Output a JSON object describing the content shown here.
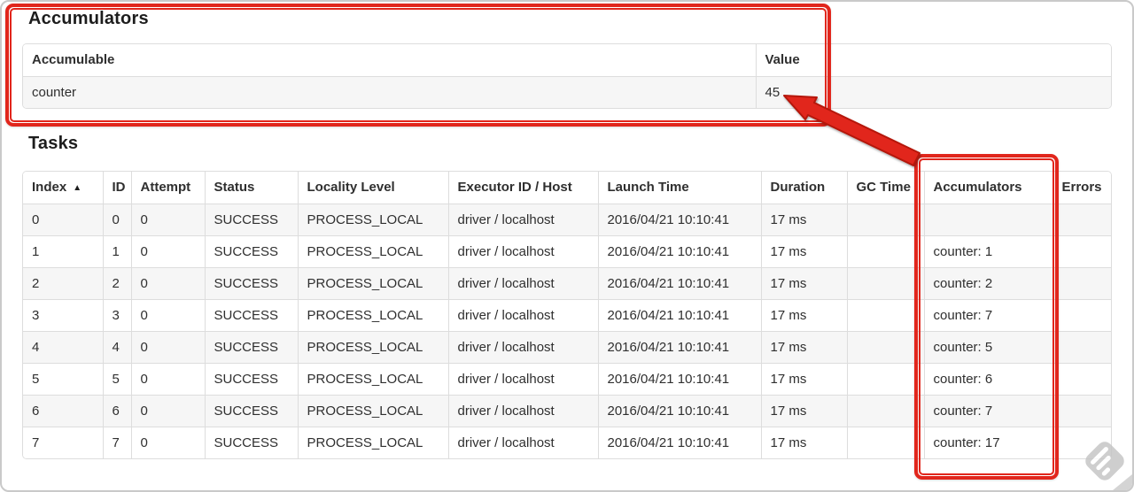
{
  "page": {
    "accumulators_heading": "Accumulators",
    "tasks_heading": "Tasks"
  },
  "accumulators_table": {
    "headers": [
      "Accumulable",
      "Value"
    ],
    "rows": [
      {
        "accumulable": "counter",
        "value": "45"
      }
    ]
  },
  "tasks_table": {
    "headers": [
      "Index",
      "ID",
      "Attempt",
      "Status",
      "Locality Level",
      "Executor ID / Host",
      "Launch Time",
      "Duration",
      "GC Time",
      "Accumulators",
      "Errors"
    ],
    "rows": [
      {
        "index": "0",
        "id": "0",
        "attempt": "0",
        "status": "SUCCESS",
        "locality": "PROCESS_LOCAL",
        "executor": "driver / localhost",
        "launch_time": "2016/04/21 10:10:41",
        "duration": "17 ms",
        "gc_time": "",
        "accumulators": "",
        "errors": ""
      },
      {
        "index": "1",
        "id": "1",
        "attempt": "0",
        "status": "SUCCESS",
        "locality": "PROCESS_LOCAL",
        "executor": "driver / localhost",
        "launch_time": "2016/04/21 10:10:41",
        "duration": "17 ms",
        "gc_time": "",
        "accumulators": "counter: 1",
        "errors": ""
      },
      {
        "index": "2",
        "id": "2",
        "attempt": "0",
        "status": "SUCCESS",
        "locality": "PROCESS_LOCAL",
        "executor": "driver / localhost",
        "launch_time": "2016/04/21 10:10:41",
        "duration": "17 ms",
        "gc_time": "",
        "accumulators": "counter: 2",
        "errors": ""
      },
      {
        "index": "3",
        "id": "3",
        "attempt": "0",
        "status": "SUCCESS",
        "locality": "PROCESS_LOCAL",
        "executor": "driver / localhost",
        "launch_time": "2016/04/21 10:10:41",
        "duration": "17 ms",
        "gc_time": "",
        "accumulators": "counter: 7",
        "errors": ""
      },
      {
        "index": "4",
        "id": "4",
        "attempt": "0",
        "status": "SUCCESS",
        "locality": "PROCESS_LOCAL",
        "executor": "driver / localhost",
        "launch_time": "2016/04/21 10:10:41",
        "duration": "17 ms",
        "gc_time": "",
        "accumulators": "counter: 5",
        "errors": ""
      },
      {
        "index": "5",
        "id": "5",
        "attempt": "0",
        "status": "SUCCESS",
        "locality": "PROCESS_LOCAL",
        "executor": "driver / localhost",
        "launch_time": "2016/04/21 10:10:41",
        "duration": "17 ms",
        "gc_time": "",
        "accumulators": "counter: 6",
        "errors": ""
      },
      {
        "index": "6",
        "id": "6",
        "attempt": "0",
        "status": "SUCCESS",
        "locality": "PROCESS_LOCAL",
        "executor": "driver / localhost",
        "launch_time": "2016/04/21 10:10:41",
        "duration": "17 ms",
        "gc_time": "",
        "accumulators": "counter: 7",
        "errors": ""
      },
      {
        "index": "7",
        "id": "7",
        "attempt": "0",
        "status": "SUCCESS",
        "locality": "PROCESS_LOCAL",
        "executor": "driver / localhost",
        "launch_time": "2016/04/21 10:10:41",
        "duration": "17 ms",
        "gc_time": "",
        "accumulators": "counter: 17",
        "errors": ""
      }
    ]
  },
  "icons": {
    "sort_ascending_icon": "▲"
  },
  "annotations": {
    "highlight_color": "#e1261c"
  }
}
